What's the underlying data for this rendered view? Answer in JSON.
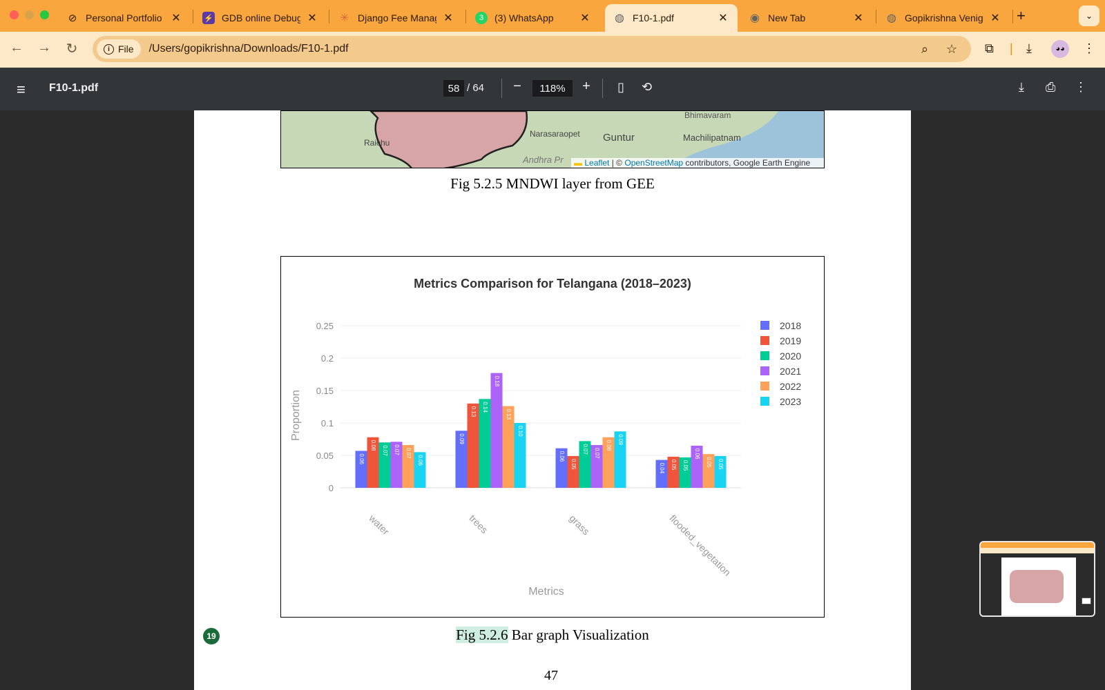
{
  "browser": {
    "tabs": [
      {
        "title": "Personal Portfolio V",
        "icon": "portfolio-icon"
      },
      {
        "title": "GDB online Debugg",
        "icon": "gdb-icon"
      },
      {
        "title": "Django Fee Manag",
        "icon": "claude-icon"
      },
      {
        "title": "(3) WhatsApp",
        "icon": "whatsapp-icon",
        "badge": "3"
      },
      {
        "title": "F10-1.pdf",
        "icon": "globe-icon",
        "active": true
      },
      {
        "title": "New Tab",
        "icon": "chrome-icon"
      },
      {
        "title": "Gopikrishna Venig",
        "icon": "globe-icon"
      }
    ],
    "chip_label": "File",
    "url": "/Users/gopikrishna/Downloads/F10-1.pdf"
  },
  "pdf": {
    "filename": "F10-1.pdf",
    "page_current": "58",
    "page_total": "/ 64",
    "zoom": "118%"
  },
  "document": {
    "map_labels": {
      "city1": "Bhimavaram",
      "city2": "Narasaraopet",
      "city3": "Guntur",
      "city4": "Machilipatnam",
      "city5": "Raichu",
      "region": "Andhra Pr"
    },
    "map_attribution": {
      "leaflet": "Leaflet",
      "sep": "| ©",
      "osm": "OpenStreetMap",
      "rest": "contributors, Google Earth Engine"
    },
    "fig1_caption": "Fig 5.2.5 MNDWI layer from GEE",
    "fig2_caption_highlight": "Fig 5.2.6",
    "fig2_caption_rest": " Bar graph Visualization",
    "page_number": "47",
    "annotation_badge": "19"
  },
  "chart_data": {
    "type": "bar",
    "title": "Metrics Comparison for Telangana (2018–2023)",
    "xlabel": "Metrics",
    "ylabel": "Proportion",
    "ylim": [
      0,
      0.25
    ],
    "yticks": [
      "0",
      "0.05",
      "0.1",
      "0.15",
      "0.2",
      "0.25"
    ],
    "categories": [
      "water",
      "trees",
      "grass",
      "flooded_vegetation"
    ],
    "legend_position": "right",
    "series": [
      {
        "name": "2018",
        "color": "#636efa",
        "values": [
          0.057,
          0.088,
          0.061,
          0.043
        ],
        "labels": [
          "0.06",
          "0.09",
          "0.06",
          "0.04"
        ]
      },
      {
        "name": "2019",
        "color": "#ef553b",
        "values": [
          0.078,
          0.13,
          0.049,
          0.048
        ],
        "labels": [
          "0.08",
          "0.13",
          "0.05",
          "0.05"
        ]
      },
      {
        "name": "2020",
        "color": "#00cc96",
        "values": [
          0.07,
          0.137,
          0.072,
          0.047
        ],
        "labels": [
          "0.07",
          "0.14",
          "0.07",
          "0.05"
        ]
      },
      {
        "name": "2021",
        "color": "#ab63fa",
        "values": [
          0.071,
          0.177,
          0.066,
          0.065
        ],
        "labels": [
          "0.07",
          "0.18",
          "0.07",
          "0.06"
        ]
      },
      {
        "name": "2022",
        "color": "#ffa15a",
        "values": [
          0.066,
          0.126,
          0.078,
          0.052
        ],
        "labels": [
          "0.07",
          "0.13",
          "0.08",
          "0.05"
        ]
      },
      {
        "name": "2023",
        "color": "#19d3f3",
        "values": [
          0.055,
          0.1,
          0.087,
          0.049
        ],
        "labels": [
          "0.06",
          "0.10",
          "0.09",
          "0.05"
        ]
      }
    ]
  }
}
